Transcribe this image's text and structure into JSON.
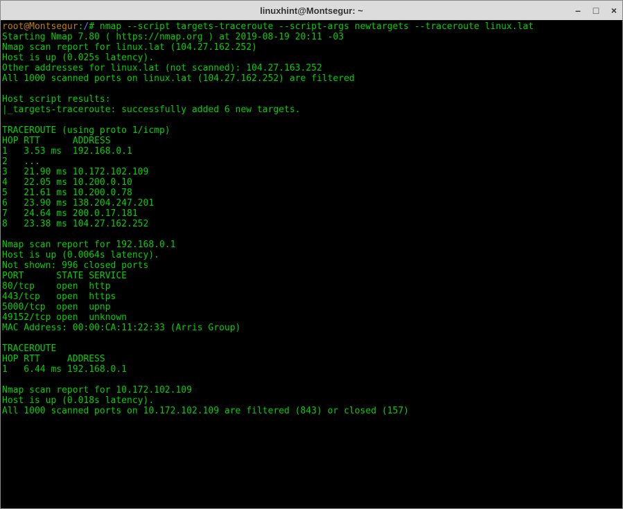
{
  "window": {
    "title": "linuxhint@Montsegur: ~"
  },
  "prompt": {
    "user": "root@Montsegur",
    "sep": ":",
    "path": "/",
    "symbol": "#"
  },
  "command": "nmap --script targets-traceroute --script-args newtargets --traceroute linux.lat",
  "lines": {
    "l1": "Starting Nmap 7.80 ( https://nmap.org ) at 2019-08-19 20:11 -03",
    "l2": "Nmap scan report for linux.lat (104.27.162.252)",
    "l3": "Host is up (0.025s latency).",
    "l4": "Other addresses for linux.lat (not scanned): 104.27.163.252",
    "l5": "All 1000 scanned ports on linux.lat (104.27.162.252) are filtered",
    "l6": "",
    "l7": "Host script results:",
    "l8": "|_targets-traceroute: successfully added 6 new targets.",
    "l9": "",
    "l10": "TRACEROUTE (using proto 1/icmp)",
    "l11": "HOP RTT      ADDRESS",
    "l12": "1   3.53 ms  192.168.0.1",
    "l13": "2   ...",
    "l14": "3   21.90 ms 10.172.102.109",
    "l15": "4   22.05 ms 10.200.0.10",
    "l16": "5   21.61 ms 10.200.0.78",
    "l17": "6   23.90 ms 138.204.247.201",
    "l18": "7   24.64 ms 200.0.17.181",
    "l19": "8   23.38 ms 104.27.162.252",
    "l20": "",
    "l21": "Nmap scan report for 192.168.0.1",
    "l22": "Host is up (0.0064s latency).",
    "l23": "Not shown: 996 closed ports",
    "l24": "PORT      STATE SERVICE",
    "l25": "80/tcp    open  http",
    "l26": "443/tcp   open  https",
    "l27": "5000/tcp  open  upnp",
    "l28": "49152/tcp open  unknown",
    "l29": "MAC Address: 00:00:CA:11:22:33 (Arris Group)",
    "l30": "",
    "l31": "TRACEROUTE",
    "l32": "HOP RTT     ADDRESS",
    "l33": "1   6.44 ms 192.168.0.1",
    "l34": "",
    "l35": "Nmap scan report for 10.172.102.109",
    "l36": "Host is up (0.018s latency).",
    "l37": "All 1000 scanned ports on 10.172.102.109 are filtered (843) or closed (157)"
  }
}
